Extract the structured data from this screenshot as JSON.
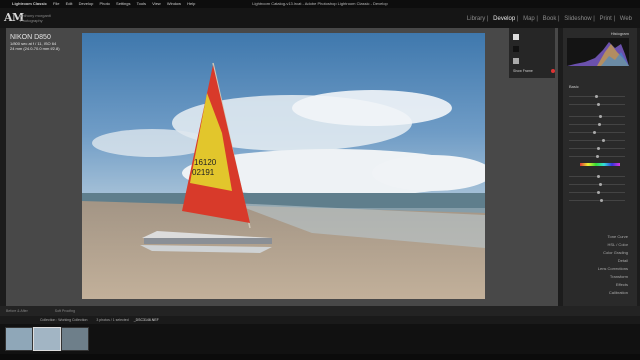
{
  "menubar": {
    "app": "Lightroom Classic",
    "items": [
      "File",
      "Edit",
      "Develop",
      "Photo",
      "Settings",
      "Tools",
      "View",
      "Window",
      "Help"
    ],
    "window_title": "Lightroom Catalog-v13.lrcat - Adobe Photoshop Lightroom Classic - Develop"
  },
  "identity": {
    "logo": "AM",
    "sub1": "anthony morganti",
    "sub2": "Photography"
  },
  "modules": [
    "Library",
    "Develop",
    "Map",
    "Book",
    "Slideshow",
    "Print",
    "Web"
  ],
  "photo_info": {
    "camera": "NIKON D850",
    "exposure": "1/800 sec at f / 11, ISO 64",
    "lens": "24 mm (24.0-70.0 mm f/2.8)"
  },
  "right_panel": {
    "histogram_label": "Histogram",
    "basic_label": "Basic",
    "sections": [
      "Tone Curve",
      "HSL / Color",
      "Color Grading",
      "Detail",
      "Lens Corrections",
      "Transform",
      "Effects",
      "Calibration"
    ],
    "previous_button": "Previous",
    "reset_button": "Reset"
  },
  "left_panel": {
    "item": "Show Frame"
  },
  "toolbar": {
    "left_text": "Before & After",
    "mid_text": "Soft Proofing"
  },
  "filmstrip": {
    "label": "Collection : Working Collection",
    "count": "3 photos / 1 selected",
    "file": "_DSC3146.NEF"
  }
}
